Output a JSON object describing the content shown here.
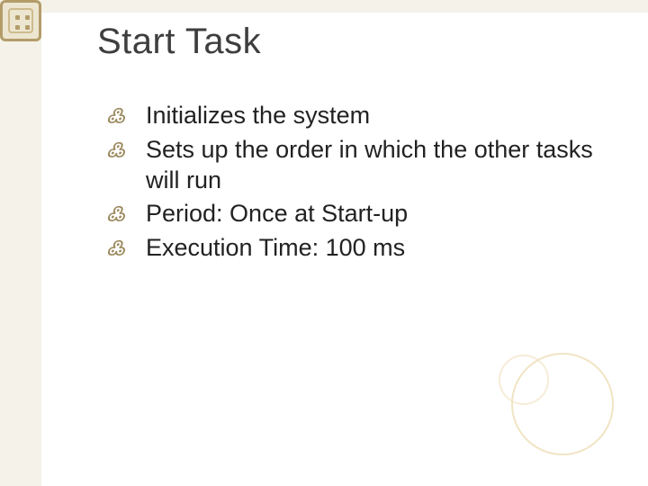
{
  "slide": {
    "title": "Start Task",
    "bullets": [
      "Initializes the system",
      "Sets up the order in which the other tasks will run",
      "Period: Once at Start-up",
      "Execution Time: 100 ms"
    ]
  }
}
